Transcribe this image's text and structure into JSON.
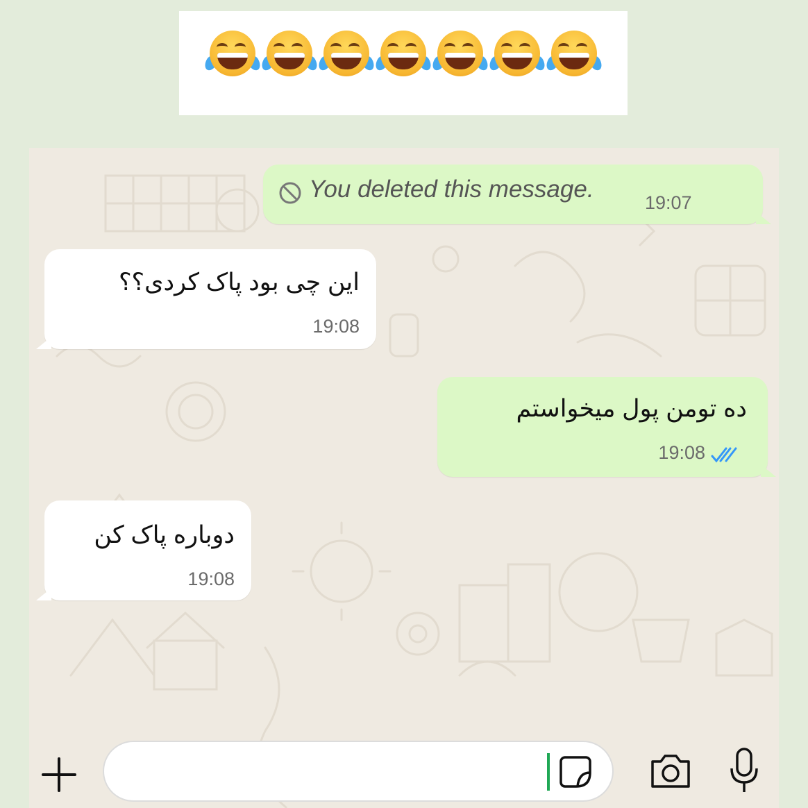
{
  "banner": {
    "emoji": [
      "face-with-tears-of-joy",
      "face-with-tears-of-joy",
      "face-with-tears-of-joy",
      "face-with-tears-of-joy",
      "face-with-tears-of-joy",
      "face-with-tears-of-joy",
      "face-with-tears-of-joy"
    ]
  },
  "messages": [
    {
      "direction": "outgoing",
      "text": "You deleted this message.",
      "time": "19:07",
      "deleted": true
    },
    {
      "direction": "incoming",
      "text": "این چی بود پاک کردی؟؟",
      "time": "19:08"
    },
    {
      "direction": "outgoing",
      "text": "ده تومن پول میخواستم",
      "time": "19:08",
      "status": "read"
    },
    {
      "direction": "incoming",
      "text": "دوباره پاک کن",
      "time": "19:08"
    }
  ],
  "composer": {
    "value": "",
    "icons": [
      "plus-icon",
      "sticker-icon",
      "camera-icon",
      "microphone-icon"
    ]
  },
  "colors": {
    "outgoing_bubble": "#dcf8c6",
    "incoming_bubble": "#ffffff",
    "chat_background": "#efeae1",
    "read_ticks": "#3497f9",
    "cursor": "#1fa855"
  }
}
